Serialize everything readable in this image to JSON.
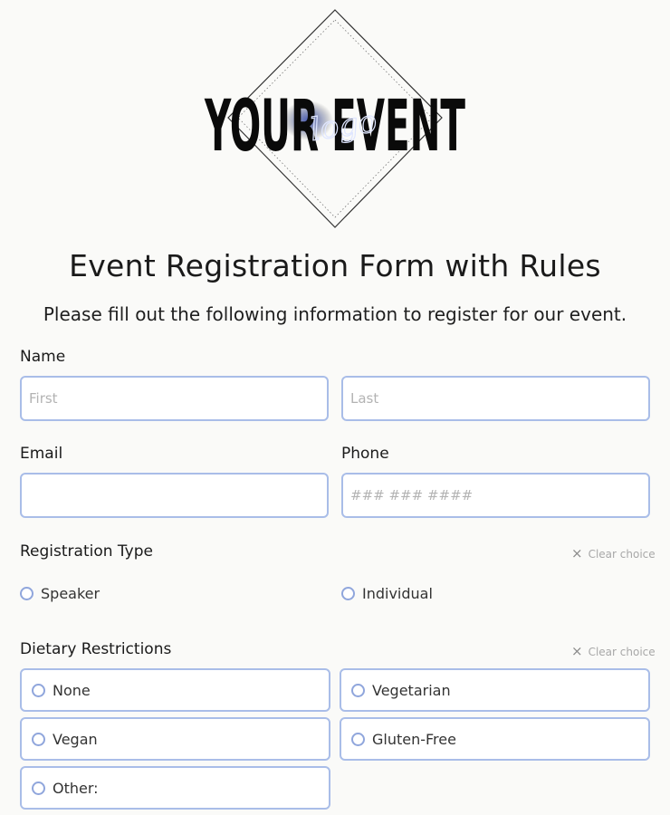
{
  "logo": {
    "main_text": "YOUR EVENT",
    "script_text": "logo"
  },
  "header": {
    "title": "Event Registration Form with Rules",
    "subtitle": "Please fill out the following information to register for our event."
  },
  "name_field": {
    "label": "Name",
    "first_placeholder": "First",
    "last_placeholder": "Last",
    "first_value": "",
    "last_value": ""
  },
  "email_field": {
    "label": "Email",
    "value": ""
  },
  "phone_field": {
    "label": "Phone",
    "placeholder": "### ### ####",
    "value": ""
  },
  "registration_type": {
    "label": "Registration Type",
    "clear_label": "Clear choice",
    "options": [
      "Speaker",
      "Individual"
    ]
  },
  "dietary": {
    "label": "Dietary Restrictions",
    "clear_label": "Clear choice",
    "options": [
      "None",
      "Vegetarian",
      "Vegan",
      "Gluten-Free",
      "Other:"
    ]
  },
  "colors": {
    "border_accent": "#a9bde8",
    "radio_accent": "#90a6dc",
    "background": "#fafaf8"
  }
}
